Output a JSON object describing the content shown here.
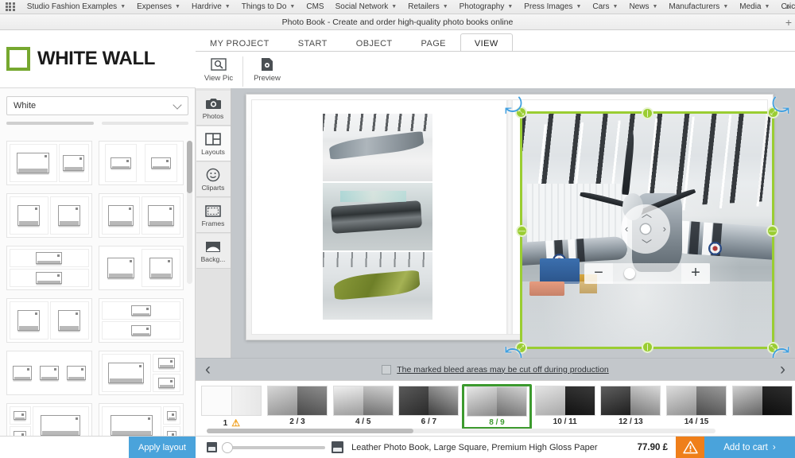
{
  "browser": {
    "apps_icon": "apps-grid-icon",
    "bookmarks": [
      {
        "label": "Studio Fashion Examples",
        "has_caret": true
      },
      {
        "label": "Expenses",
        "has_caret": true
      },
      {
        "label": "Hardrive",
        "has_caret": true
      },
      {
        "label": "Things to Do",
        "has_caret": true
      },
      {
        "label": "CMS",
        "has_caret": false
      },
      {
        "label": "Social Network",
        "has_caret": true
      },
      {
        "label": "Retailers",
        "has_caret": true
      },
      {
        "label": "Photography",
        "has_caret": true
      },
      {
        "label": "Press Images",
        "has_caret": true
      },
      {
        "label": "Cars",
        "has_caret": true
      },
      {
        "label": "News",
        "has_caret": true
      },
      {
        "label": "Manufacturers",
        "has_caret": true
      },
      {
        "label": "Media",
        "has_caret": true
      },
      {
        "label": "Cricket",
        "has_caret": true
      }
    ],
    "overflow": "»",
    "page_title": "Photo Book - Create and order high-quality photo books online",
    "new_tab": "+"
  },
  "brand": {
    "name": "WHITE WALL",
    "logo_color": "#76a82f"
  },
  "ribbon": {
    "tabs": [
      {
        "label": "MY PROJECT",
        "active": false
      },
      {
        "label": "START",
        "active": false
      },
      {
        "label": "OBJECT",
        "active": false
      },
      {
        "label": "PAGE",
        "active": false
      },
      {
        "label": "VIEW",
        "active": true
      }
    ],
    "buttons": [
      {
        "label": "View Pic",
        "icon": "magnifier-icon"
      },
      {
        "label": "Preview",
        "icon": "preview-page-icon"
      }
    ]
  },
  "left_panel": {
    "background_select": {
      "value": "White",
      "placeholder": "White",
      "icon": "chevron-down-icon"
    },
    "apply_label": "Apply layout",
    "layouts": [
      {
        "kind": "big-left-small-right"
      },
      {
        "kind": "two-portrait"
      },
      {
        "kind": "two-equal"
      },
      {
        "kind": "two-equal-wide"
      },
      {
        "kind": "two-stacked"
      },
      {
        "kind": "two-equal-right-focus"
      },
      {
        "kind": "two-equal"
      },
      {
        "kind": "two-stacked-narrow"
      },
      {
        "kind": "three-across"
      },
      {
        "kind": "one-big-two-right"
      },
      {
        "kind": "two-left-one-big"
      },
      {
        "kind": "one-big-two-small-right"
      }
    ]
  },
  "tool_rail": [
    {
      "label": "Photos",
      "icon": "camera-icon",
      "active": false
    },
    {
      "label": "Layouts",
      "icon": "layout-grid-icon",
      "active": true
    },
    {
      "label": "Cliparts",
      "icon": "smiley-icon",
      "active": false
    },
    {
      "label": "Frames",
      "icon": "frame-icon",
      "active": false
    },
    {
      "label": "Backg...",
      "icon": "background-icon",
      "active": false
    }
  ],
  "canvas": {
    "selection": {
      "frame_color": "#9acd32",
      "rotate_handle_color": "#3f9fe0",
      "pan_icon": "pan-dpad-icon",
      "zoom_minus": "−",
      "zoom_plus": "+"
    },
    "object_toolbar": [
      {
        "icon": "rotate-right-icon"
      },
      {
        "icon": "rotate-left-icon"
      },
      {
        "icon": "fit-to-frame-icon"
      },
      {
        "icon": "hand-move-icon"
      },
      {
        "icon": "trash-icon"
      }
    ],
    "prev_page": "‹",
    "next_page": "›",
    "bleed_notice": "The marked bleed areas may be cut off during production",
    "bleed_checked": false
  },
  "thumbnails": [
    {
      "label": "1",
      "warning": true,
      "selected": false,
      "kind": "cover"
    },
    {
      "label": "2 / 3",
      "warning": false,
      "selected": false,
      "kind": "spread-a"
    },
    {
      "label": "4 / 5",
      "warning": false,
      "selected": false,
      "kind": "spread-b"
    },
    {
      "label": "6 / 7",
      "warning": false,
      "selected": false,
      "kind": "spread-c"
    },
    {
      "label": "8 / 9",
      "warning": false,
      "selected": true,
      "kind": "spread-d"
    },
    {
      "label": "10 / 11",
      "warning": false,
      "selected": false,
      "kind": "spread-e"
    },
    {
      "label": "12 / 13",
      "warning": false,
      "selected": false,
      "kind": "spread-f"
    },
    {
      "label": "14 / 15",
      "warning": false,
      "selected": false,
      "kind": "spread-g"
    }
  ],
  "status_bar": {
    "small_icon": "small-thumbnail-icon",
    "large_icon": "large-thumbnail-icon",
    "product": "Leather Photo Book, Large Square, Premium High Gloss Paper",
    "price": "77.90 £",
    "warning_icon": "warning-triangle-icon",
    "cart_label": "Add to cart",
    "cart_arrow": "›",
    "accent_blue": "#4aa3db",
    "accent_orange": "#ef7f1a"
  }
}
